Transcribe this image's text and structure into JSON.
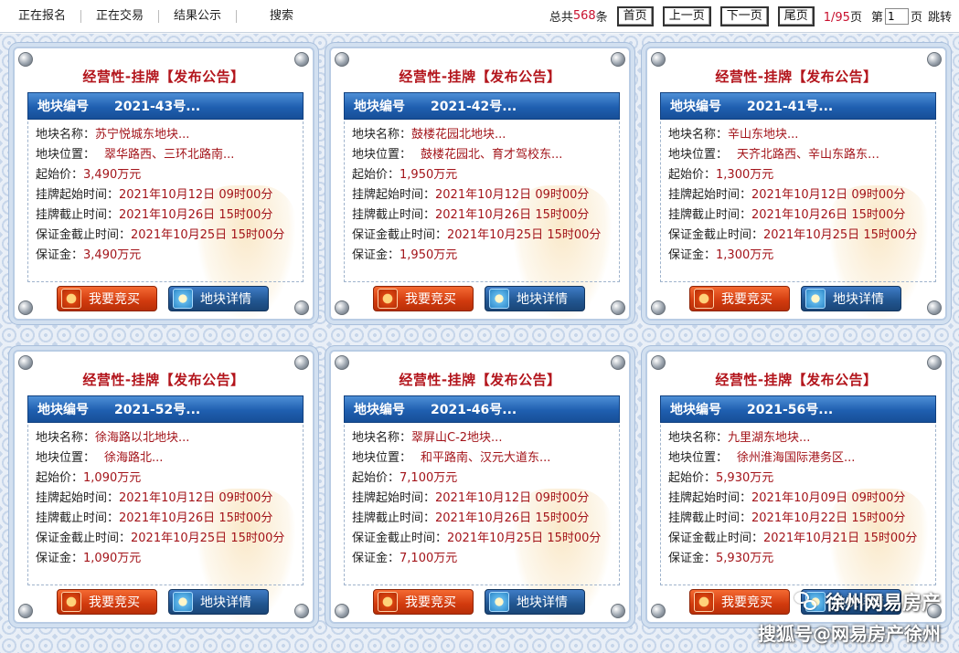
{
  "nav": {
    "items": [
      "正在报名",
      "正在交易",
      "结果公示",
      "搜索"
    ]
  },
  "pager": {
    "total_prefix": "总共",
    "total_count": "568",
    "total_suffix": "条",
    "first": "首页",
    "prev": "上一页",
    "next": "下一页",
    "last": "尾页",
    "current": "1",
    "slash_total": "/95",
    "page_unit": "页",
    "goto_prefix": "第",
    "goto_value": "1",
    "goto_suffix": "页",
    "jump": "跳转"
  },
  "labels": {
    "header_label": "地块编号",
    "name": "地块名称：",
    "location": "地块位置：",
    "start_price": "起始价：",
    "listing_start": "挂牌起始时间：",
    "listing_end": "挂牌截止时间：",
    "deposit_deadline": "保证金截止时间：",
    "deposit": "保证金：",
    "bid_button": "我要竞买",
    "detail_button": "地块详情"
  },
  "cards": [
    {
      "title": "经营性-挂牌【发布公告】",
      "code": "2021-43号...",
      "name": "苏宁悦城东地块...",
      "location": "翠华路西、三环北路南...",
      "start_price": "3,490万元",
      "listing_start": "2021年10月12日 09时00分",
      "listing_end": "2021年10月26日 15时00分",
      "deposit_deadline": "2021年10月25日 15时00分",
      "deposit": "3,490万元"
    },
    {
      "title": "经营性-挂牌【发布公告】",
      "code": "2021-42号...",
      "name": "鼓楼花园北地块...",
      "location": "鼓楼花园北、育才驾校东...",
      "start_price": "1,950万元",
      "listing_start": "2021年10月12日 09时00分",
      "listing_end": "2021年10月26日 15时00分",
      "deposit_deadline": "2021年10月25日 15时00分",
      "deposit": "1,950万元"
    },
    {
      "title": "经营性-挂牌【发布公告】",
      "code": "2021-41号...",
      "name": "辛山东地块...",
      "location": "天齐北路西、辛山东路东…",
      "start_price": "1,300万元",
      "listing_start": "2021年10月12日 09时00分",
      "listing_end": "2021年10月26日 15时00分",
      "deposit_deadline": "2021年10月25日 15时00分",
      "deposit": "1,300万元"
    },
    {
      "title": "经营性-挂牌【发布公告】",
      "code": "2021-52号...",
      "name": "徐海路以北地块...",
      "location": "徐海路北...",
      "start_price": "1,090万元",
      "listing_start": "2021年10月12日 09时00分",
      "listing_end": "2021年10月26日 15时00分",
      "deposit_deadline": "2021年10月25日 15时00分",
      "deposit": "1,090万元"
    },
    {
      "title": "经营性-挂牌【发布公告】",
      "code": "2021-46号...",
      "name": "翠屏山C-2地块...",
      "location": "和平路南、汉元大道东...",
      "start_price": "7,100万元",
      "listing_start": "2021年10月12日 09时00分",
      "listing_end": "2021年10月26日 15时00分",
      "deposit_deadline": "2021年10月25日 15时00分",
      "deposit": "7,100万元"
    },
    {
      "title": "经营性-挂牌【发布公告】",
      "code": "2021-56号...",
      "name": "九里湖东地块...",
      "location": "徐州淮海国际港务区...",
      "start_price": "5,930万元",
      "listing_start": "2021年10月09日 09时00分",
      "listing_end": "2021年10月22日 15时00分",
      "deposit_deadline": "2021年10月21日 15时00分",
      "deposit": "5,930万元"
    }
  ],
  "source_watermark": {
    "line1": "徐州网易房产",
    "line2": "搜狐号@网易房产徐州"
  },
  "colors": {
    "title_red": "#b3151c",
    "value_red": "#a3141a",
    "header_blue": "#1f5fb0",
    "bid_orange": "#d13a0e",
    "detail_blue": "#21558f",
    "count_red": "#c8102e"
  }
}
